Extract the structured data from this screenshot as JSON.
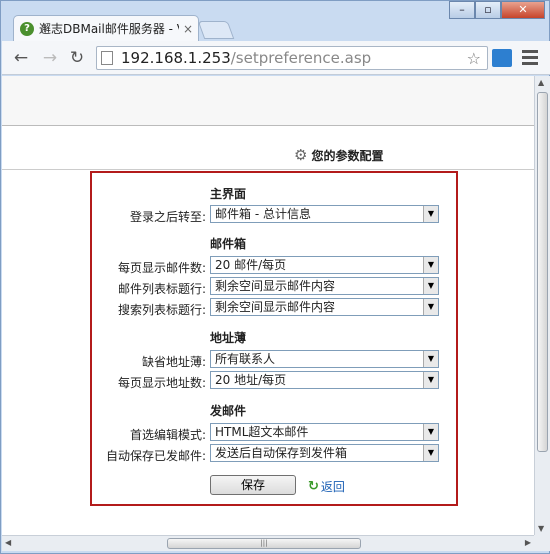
{
  "browser": {
    "tab_title": "邂志DBMail邮件服务器 - V",
    "tab_close": "×",
    "url_host": "192.168.1.253",
    "url_path": "/setpreference.asp",
    "window_controls": {
      "minimize": "–",
      "maximize": "▫",
      "close": "✕"
    }
  },
  "page": {
    "title": "您的参数配置",
    "sections": {
      "main": {
        "title": "主界面",
        "login_label": "登录之后转至:",
        "login_value": "邮件箱 - 总计信息"
      },
      "mailbox": {
        "title": "邮件箱",
        "per_page_label": "每页显示邮件数:",
        "per_page_value": "20 邮件/每页",
        "list_title_label": "邮件列表标题行:",
        "list_title_value": "剩余空间显示邮件内容",
        "search_title_label": "搜索列表标题行:",
        "search_title_value": "剩余空间显示邮件内容"
      },
      "addressbook": {
        "title": "地址薄",
        "default_label": "缺省地址薄:",
        "default_value": "所有联系人",
        "per_page_label": "每页显示地址数:",
        "per_page_value": "20 地址/每页"
      },
      "send": {
        "title": "发邮件",
        "editor_label": "首选编辑模式:",
        "editor_value": "HTML超文本邮件",
        "autosave_label": "自动保存已发邮件:",
        "autosave_value": "发送后自动保存到发件箱"
      }
    },
    "save_button": "保存",
    "back_link": "返回"
  },
  "colors": {
    "panel_border": "#b31b1b",
    "link": "#1a5fb4"
  }
}
